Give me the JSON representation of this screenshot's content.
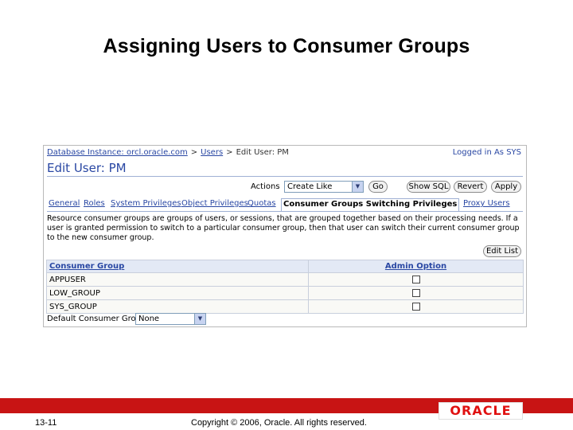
{
  "slide": {
    "title": "Assigning Users to Consumer Groups",
    "number": "13-11",
    "copyright": "Copyright © 2006, Oracle. All rights reserved.",
    "logo": "ORACLE"
  },
  "app": {
    "breadcrumb": {
      "instance": "Database Instance: orcl.oracle.com",
      "users": "Users",
      "current": "Edit User: PM"
    },
    "logged_in": "Logged in As SYS",
    "page_title": "Edit User: PM",
    "actions": {
      "label": "Actions",
      "selected": "Create Like",
      "go": "Go",
      "show_sql": "Show SQL",
      "revert": "Revert",
      "apply": "Apply"
    },
    "tabs": [
      {
        "label": "General"
      },
      {
        "label": "Roles"
      },
      {
        "label": "System Privileges"
      },
      {
        "label": "Object Privileges"
      },
      {
        "label": "Quotas"
      },
      {
        "label": "Consumer Groups Switching Privileges",
        "active": true
      },
      {
        "label": "Proxy Users"
      }
    ],
    "description": "Resource consumer groups are groups of users, or sessions, that are grouped together based on their processing needs. If a user is granted permission to switch to a particular consumer group, then that user can switch their current consumer group to the new consumer group.",
    "edit_list": "Edit List",
    "table": {
      "headers": [
        "Consumer Group",
        "Admin Option"
      ],
      "rows": [
        {
          "group": "APPUSER",
          "admin": false
        },
        {
          "group": "LOW_GROUP",
          "admin": false
        },
        {
          "group": "SYS_GROUP",
          "admin": false
        }
      ]
    },
    "default_group": {
      "label": "Default Consumer Group",
      "selected": "None"
    },
    "colors": {
      "link": "#2947a3",
      "header_bg": "#e3e9f5",
      "oracle_red": "#c81414"
    }
  }
}
